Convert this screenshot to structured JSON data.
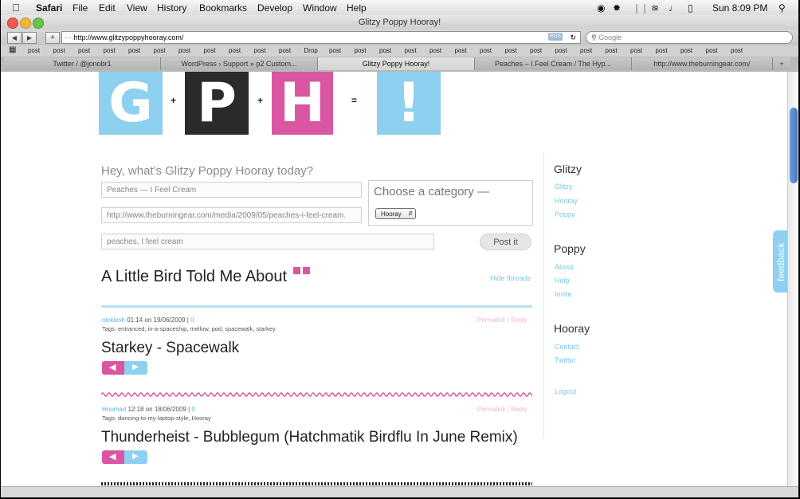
{
  "menubar": {
    "app": "Safari",
    "items": [
      "File",
      "Edit",
      "View",
      "History",
      "Bookmarks",
      "Develop",
      "Window",
      "Help"
    ],
    "clock": "Sun 8:09 PM"
  },
  "window": {
    "title": "Glitzy Poppy Hooray!"
  },
  "toolbar": {
    "url": "http://www.glitzypoppyhooray.com/",
    "search_placeholder": "Google",
    "rss": "RSS"
  },
  "bookmarks": [
    "post",
    "post",
    "post",
    "post",
    "post",
    "post",
    "post",
    "post",
    "post",
    "post",
    "post",
    "Drop",
    "post",
    "post",
    "post",
    "post",
    "post",
    "post",
    "post",
    "post",
    "post",
    "post",
    "post",
    "post",
    "post",
    "post",
    "post",
    "post",
    "post"
  ],
  "tabs": [
    "Twitter / @jonobr1",
    "WordPress › Support » p2 Custom...",
    "Glitzy Poppy Hooray!",
    "Peaches – I Feel Cream / The Hyp...",
    "http://www.theburningear.com/"
  ],
  "logo": {
    "letters": [
      "G",
      "P",
      "H",
      "!"
    ],
    "ops": [
      "+",
      "+",
      "="
    ],
    "colors": [
      "#8dd0ef",
      "#2b2b2b",
      "#d956a2",
      "#8dd0ef"
    ]
  },
  "form": {
    "prompt": "Hey, what's Glitzy Poppy Hooray today?",
    "title_value": "Peaches — I Feel Cream",
    "url_value": "http://www.theburningear.com/media/2009/05/peaches-i-feel-cream.",
    "tags_value": "peaches, I feel cream",
    "category_label": "Choose a category —",
    "category_selected": "Hooray",
    "post_button": "Post it"
  },
  "feed": {
    "heading": "A Little Bird Told Me About",
    "hide_threads": "Hide threads",
    "posts": [
      {
        "user": "nicklesh",
        "time": "01:14 on 19/06/2009",
        "comments": "0",
        "tags": "Tags: entranced, in-a-spaceship, mellow, pod, spacewalk, starkey",
        "links": "Permalink | Reply",
        "title": "Starkey - Spacewalk"
      },
      {
        "user": "Hnomad",
        "time": "12:18 on 18/06/2009",
        "comments": "0",
        "tags": "Tags: dancing-to-my-laptop-style, Hooray",
        "links": "Permalink | Reply",
        "title": "Thunderheist - Bubblegum (Hatchmatik Birdflu In June Remix)"
      }
    ]
  },
  "sidebar": {
    "sections": [
      {
        "heading": "Glitzy",
        "links": [
          "Glitzy",
          "Hooray",
          "Poppy"
        ]
      },
      {
        "heading": "Poppy",
        "links": [
          "About",
          "Help",
          "Invite"
        ]
      },
      {
        "heading": "Hooray",
        "links": [
          "Contact",
          "Twitter"
        ]
      }
    ],
    "logout": "Logout"
  },
  "feedback_tab": "feedback"
}
